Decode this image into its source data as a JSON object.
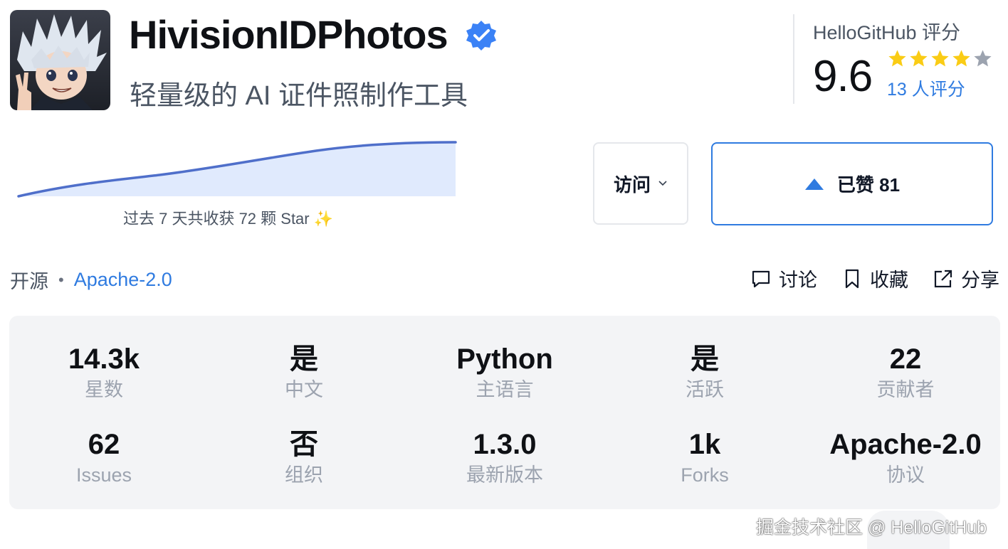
{
  "header": {
    "title": "HivisionIDPhotos",
    "subtitle": "轻量级的 AI 证件照制作工具",
    "avatar_icon": "anime-avatar-icon",
    "verified_icon": "verified-badge-icon"
  },
  "rating": {
    "label": "HelloGitHub 评分",
    "score": "9.6",
    "stars_filled": 4,
    "stars_total": 5,
    "count": "13 人评分",
    "star_color": "#facc15",
    "star_empty_color": "#9ca3af"
  },
  "sparkline": {
    "caption": "过去 7 天共收获 72 颗 Star ✨",
    "line_color": "#4f6fca",
    "fill_color": "#e0eafd"
  },
  "buttons": {
    "visit_label": "访问",
    "like_label": "已赞 81"
  },
  "meta": {
    "open_source": "开源",
    "dot": "•",
    "license": "Apache-2.0"
  },
  "actions": {
    "discuss": "讨论",
    "collect": "收藏",
    "share": "分享"
  },
  "stats": [
    {
      "value": "14.3k",
      "label": "星数"
    },
    {
      "value": "是",
      "label": "中文"
    },
    {
      "value": "Python",
      "label": "主语言"
    },
    {
      "value": "是",
      "label": "活跃"
    },
    {
      "value": "22",
      "label": "贡献者"
    },
    {
      "value": "62",
      "label": "Issues"
    },
    {
      "value": "否",
      "label": "组织"
    },
    {
      "value": "1.3.0",
      "label": "最新版本"
    },
    {
      "value": "1k",
      "label": "Forks"
    },
    {
      "value": "Apache-2.0",
      "label": "协议"
    }
  ],
  "watermark": "掘金技术社区 @ HelloGitHub",
  "accent": "#2f7be0"
}
